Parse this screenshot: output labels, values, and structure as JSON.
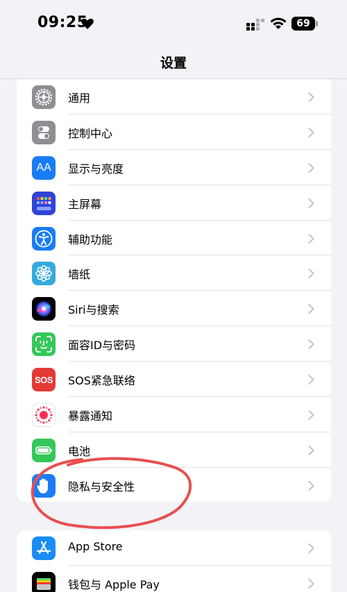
{
  "status_bar": {
    "time": "09:25",
    "battery": "69"
  },
  "nav": {
    "title": "设置"
  },
  "group1": [
    {
      "label": "通用",
      "icon": "gear-icon",
      "color": "#8e8e93"
    },
    {
      "label": "控制中心",
      "icon": "toggles-icon",
      "color": "#8e8e93"
    },
    {
      "label": "显示与亮度",
      "icon": "text-size-icon",
      "color": "#1a7cf5"
    },
    {
      "label": "主屏幕",
      "icon": "home-grid-icon",
      "color": "#2f45d8"
    },
    {
      "label": "辅助功能",
      "icon": "accessibility-icon",
      "color": "#1a7cf5"
    },
    {
      "label": "墙纸",
      "icon": "flower-icon",
      "color": "#34aadc"
    },
    {
      "label": "Siri与搜索",
      "icon": "siri-icon",
      "color": "#000000"
    },
    {
      "label": "面容ID与密码",
      "icon": "face-id-icon",
      "color": "#34c759"
    },
    {
      "label": "SOS紧急联络",
      "icon": "sos-icon",
      "color": "#e53935"
    },
    {
      "label": "暴露通知",
      "icon": "exposure-icon",
      "color": "#ffffff"
    },
    {
      "label": "电池",
      "icon": "battery-icon",
      "color": "#34c759"
    },
    {
      "label": "隐私与安全性",
      "icon": "hand-icon",
      "color": "#1a7cf5"
    }
  ],
  "sos_text": "SOS",
  "aa_text": "AA",
  "group2": [
    {
      "label": "App Store",
      "icon": "app-store-icon",
      "color": "#1a8cf5"
    },
    {
      "label": "钱包与 Apple Pay",
      "icon": "wallet-icon",
      "color": "#000000"
    }
  ]
}
